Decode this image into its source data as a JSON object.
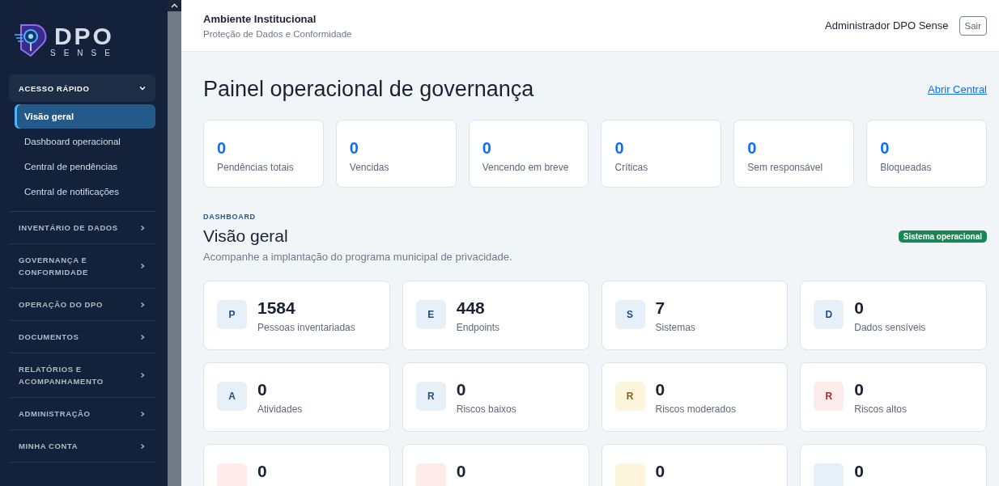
{
  "brand": {
    "name": "DPO",
    "tagline": "SENSE"
  },
  "sidebar": {
    "sections": [
      {
        "label": "ACESSO RÁPIDO",
        "expanded": true,
        "items": [
          {
            "label": "Visão geral",
            "selected": true
          },
          {
            "label": "Dashboard operacional",
            "selected": false
          },
          {
            "label": "Central de pendências",
            "selected": false
          },
          {
            "label": "Central de notificações",
            "selected": false
          }
        ]
      },
      {
        "label": "INVENTÁRIO DE DADOS",
        "expanded": false
      },
      {
        "label": "GOVERNANÇA E CONFORMIDADE",
        "expanded": false
      },
      {
        "label": "OPERAÇÃO DO DPO",
        "expanded": false
      },
      {
        "label": "DOCUMENTOS",
        "expanded": false
      },
      {
        "label": "RELATÓRIOS E ACOMPANHAMENTO",
        "expanded": false
      },
      {
        "label": "ADMINISTRAÇÃO",
        "expanded": false
      },
      {
        "label": "MINHA CONTA",
        "expanded": false
      }
    ]
  },
  "header": {
    "title": "Ambiente Institucional",
    "subtitle": "Proteção de Dados e Conformidade",
    "user": "Administrador DPO Sense",
    "logout": "Sair"
  },
  "page": {
    "title": "Painel operacional de governança",
    "link": "Abrir Central"
  },
  "pending_stats": [
    {
      "value": "0",
      "label": "Pendências totais"
    },
    {
      "value": "0",
      "label": "Vencidas"
    },
    {
      "value": "0",
      "label": "Vencendo em breve"
    },
    {
      "value": "0",
      "label": "Críticas"
    },
    {
      "value": "0",
      "label": "Sem responsável"
    },
    {
      "value": "0",
      "label": "Bloqueadas"
    }
  ],
  "dashboard": {
    "eyebrow": "DASHBOARD",
    "title": "Visão geral",
    "status": "Sistema operacional",
    "description": "Acompanhe a implantação do programa municipal de privacidade."
  },
  "metrics": [
    {
      "letter": "P",
      "value": "1584",
      "label": "Pessoas inventariadas",
      "kind": "info"
    },
    {
      "letter": "E",
      "value": "448",
      "label": "Endpoints",
      "kind": "info"
    },
    {
      "letter": "S",
      "value": "7",
      "label": "Sistemas",
      "kind": "info"
    },
    {
      "letter": "D",
      "value": "0",
      "label": "Dados sensíveis",
      "kind": "info"
    },
    {
      "letter": "A",
      "value": "0",
      "label": "Atividades",
      "kind": "info"
    },
    {
      "letter": "R",
      "value": "0",
      "label": "Riscos baixos",
      "kind": "info"
    },
    {
      "letter": "R",
      "value": "0",
      "label": "Riscos moderados",
      "kind": "warning"
    },
    {
      "letter": "R",
      "value": "0",
      "label": "Riscos altos",
      "kind": "danger"
    },
    {
      "value": "0",
      "kind": "danger"
    },
    {
      "value": "0",
      "kind": "danger"
    },
    {
      "value": "0",
      "kind": "warning"
    },
    {
      "value": "0",
      "kind": "info"
    }
  ]
}
